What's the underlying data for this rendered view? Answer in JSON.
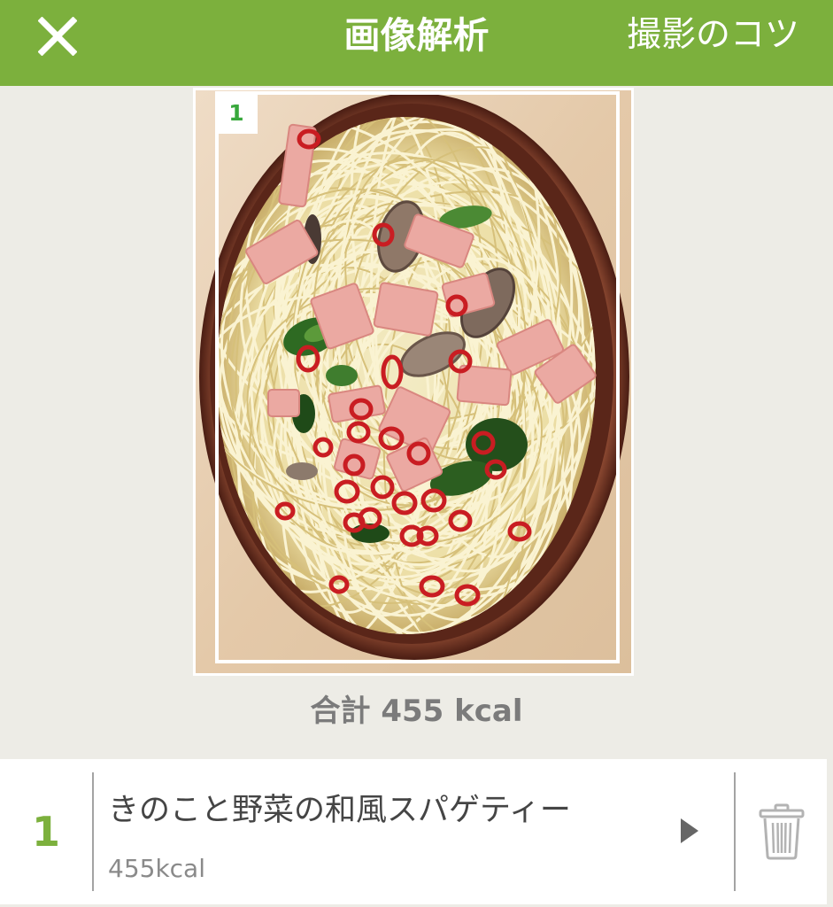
{
  "header": {
    "title": "画像解析",
    "tips_label": "撮影のコツ",
    "close_icon": "close-icon"
  },
  "photo": {
    "detections": [
      {
        "label": "1"
      }
    ]
  },
  "summary": {
    "total_label": "合計",
    "total_value": "455 kcal"
  },
  "items": [
    {
      "index": "1",
      "name": "きのこと野菜の和風スパゲティー",
      "kcal": "455kcal",
      "detail_icon": "chevron-right-icon",
      "delete_icon": "trash-icon"
    }
  ],
  "colors": {
    "accent": "#7cb03d",
    "background": "#edece6",
    "text": "#454545",
    "sub": "#8a8a8a",
    "label-green": "#38a83c",
    "total": "#7b7b7b"
  }
}
